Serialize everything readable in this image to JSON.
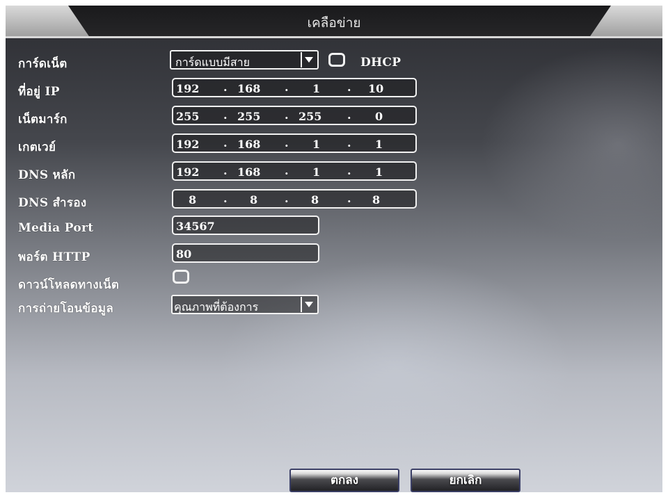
{
  "window": {
    "title": "เคลือข่าย"
  },
  "rows": {
    "network_card": {
      "label": "การ์ดเน็ต",
      "value": "การ์ดแบบมีสาย",
      "dhcp_label": "DHCP",
      "dhcp_checked": false
    },
    "ip_address": {
      "label": "ที่อยู่ IP",
      "octets": [
        "192",
        "168",
        "1",
        "10"
      ]
    },
    "netmask": {
      "label": "เน็ตมาร์ก",
      "octets": [
        "255",
        "255",
        "255",
        "0"
      ]
    },
    "gateway": {
      "label": "เกตเวย์",
      "octets": [
        "192",
        "168",
        "1",
        "1"
      ]
    },
    "dns_primary": {
      "label": "DNS หลัก",
      "octets": [
        "192",
        "168",
        "1",
        "1"
      ]
    },
    "dns_secondary": {
      "label": "DNS สำรอง",
      "octets": [
        "8",
        "8",
        "8",
        "8"
      ]
    },
    "media_port": {
      "label": "Media Port",
      "value": "34567"
    },
    "http_port": {
      "label": "พอร์ต HTTP",
      "value": "80"
    },
    "net_download": {
      "label": "ดาวน์โหลดทางเน็ต",
      "checked": false
    },
    "transfer": {
      "label": "การถ่ายโอนข้อมูล",
      "value": "คุณภาพที่ต้องการ"
    }
  },
  "buttons": {
    "ok": "ตกลง",
    "cancel": "ยกเลิก"
  },
  "icons": {
    "dropdown": "chevron-down-icon"
  },
  "colors": {
    "text": "#ffffff",
    "field_border": "#f2f2f2",
    "button_border": "#3b3f66"
  }
}
